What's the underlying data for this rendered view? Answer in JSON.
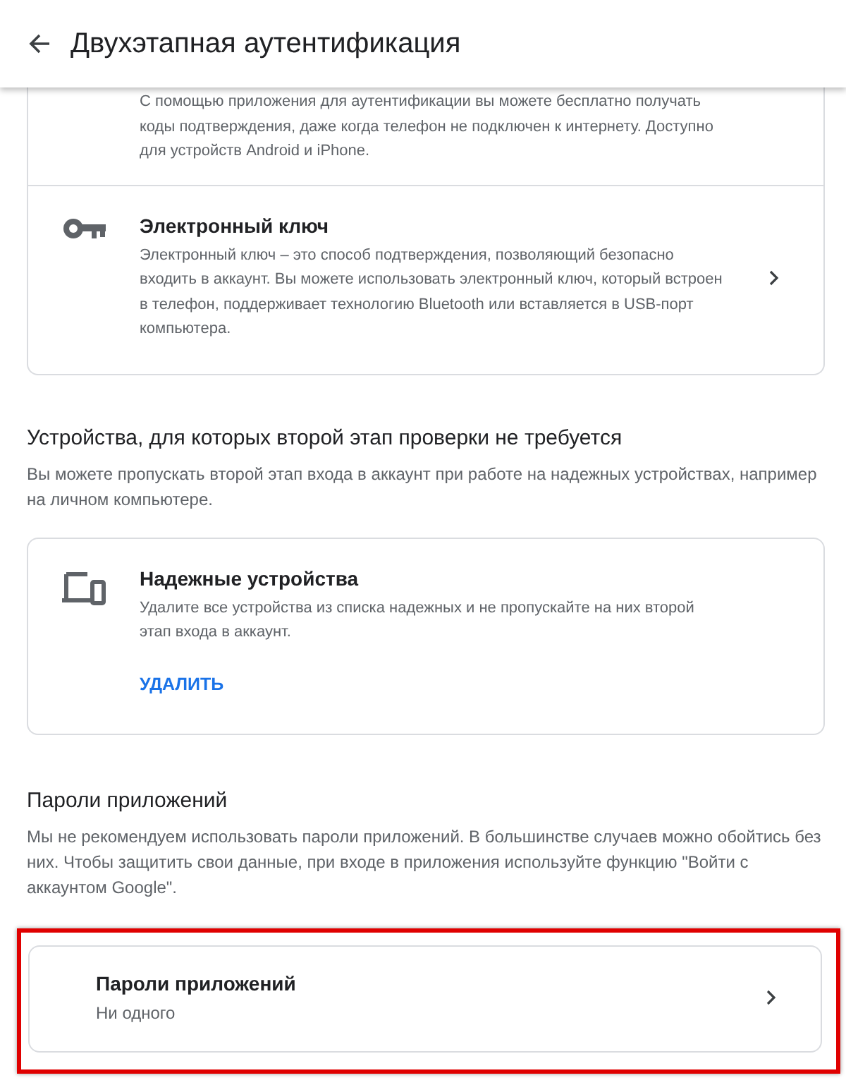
{
  "header": {
    "title": "Двухэтапная аутентификация"
  },
  "sections": [
    {
      "card": {
        "highlighted": false,
        "items": [
          {
            "kind": "partial",
            "description": "С помощью приложения для аутентификации вы можете бесплатно получать коды подтверждения, даже когда телефон не подключен к интернету. Доступно для устройств Android и iPhone.",
            "chevron": false
          },
          {
            "kind": "key",
            "title": "Электронный ключ",
            "description": "Электронный ключ – это способ подтверждения, позволяющий безопасно входить в аккаунт. Вы можете использовать электронный ключ, который встроен в телефон, поддерживает технологию Bluetooth или вставляется в USB-порт компьютера.",
            "chevron": true
          }
        ]
      }
    },
    {
      "heading": "Устройства, для которых второй этап проверки не требуется",
      "description": "Вы можете пропускать второй этап входа в аккаунт при работе на надежных устройствах, например на личном компьютере.",
      "card": {
        "highlighted": false,
        "items": [
          {
            "kind": "devices",
            "title": "Надежные устройства",
            "description": "Удалите все устройства из списка надежных и не пропускайте на них второй этап входа в аккаунт.",
            "action": "УДАЛИТЬ",
            "chevron": false
          }
        ]
      }
    },
    {
      "heading": "Пароли приложений",
      "description": "Мы не рекомендуем использовать пароли приложений. В большинстве случаев можно обойтись без них. Чтобы защитить свои данные, при входе в приложения используйте функцию \"Войти с аккаунтом Google\".",
      "card": {
        "highlighted": true,
        "items": [
          {
            "kind": "summary",
            "title": "Пароли приложений",
            "subtitle": "Ни одного",
            "chevron": true
          }
        ]
      }
    }
  ]
}
